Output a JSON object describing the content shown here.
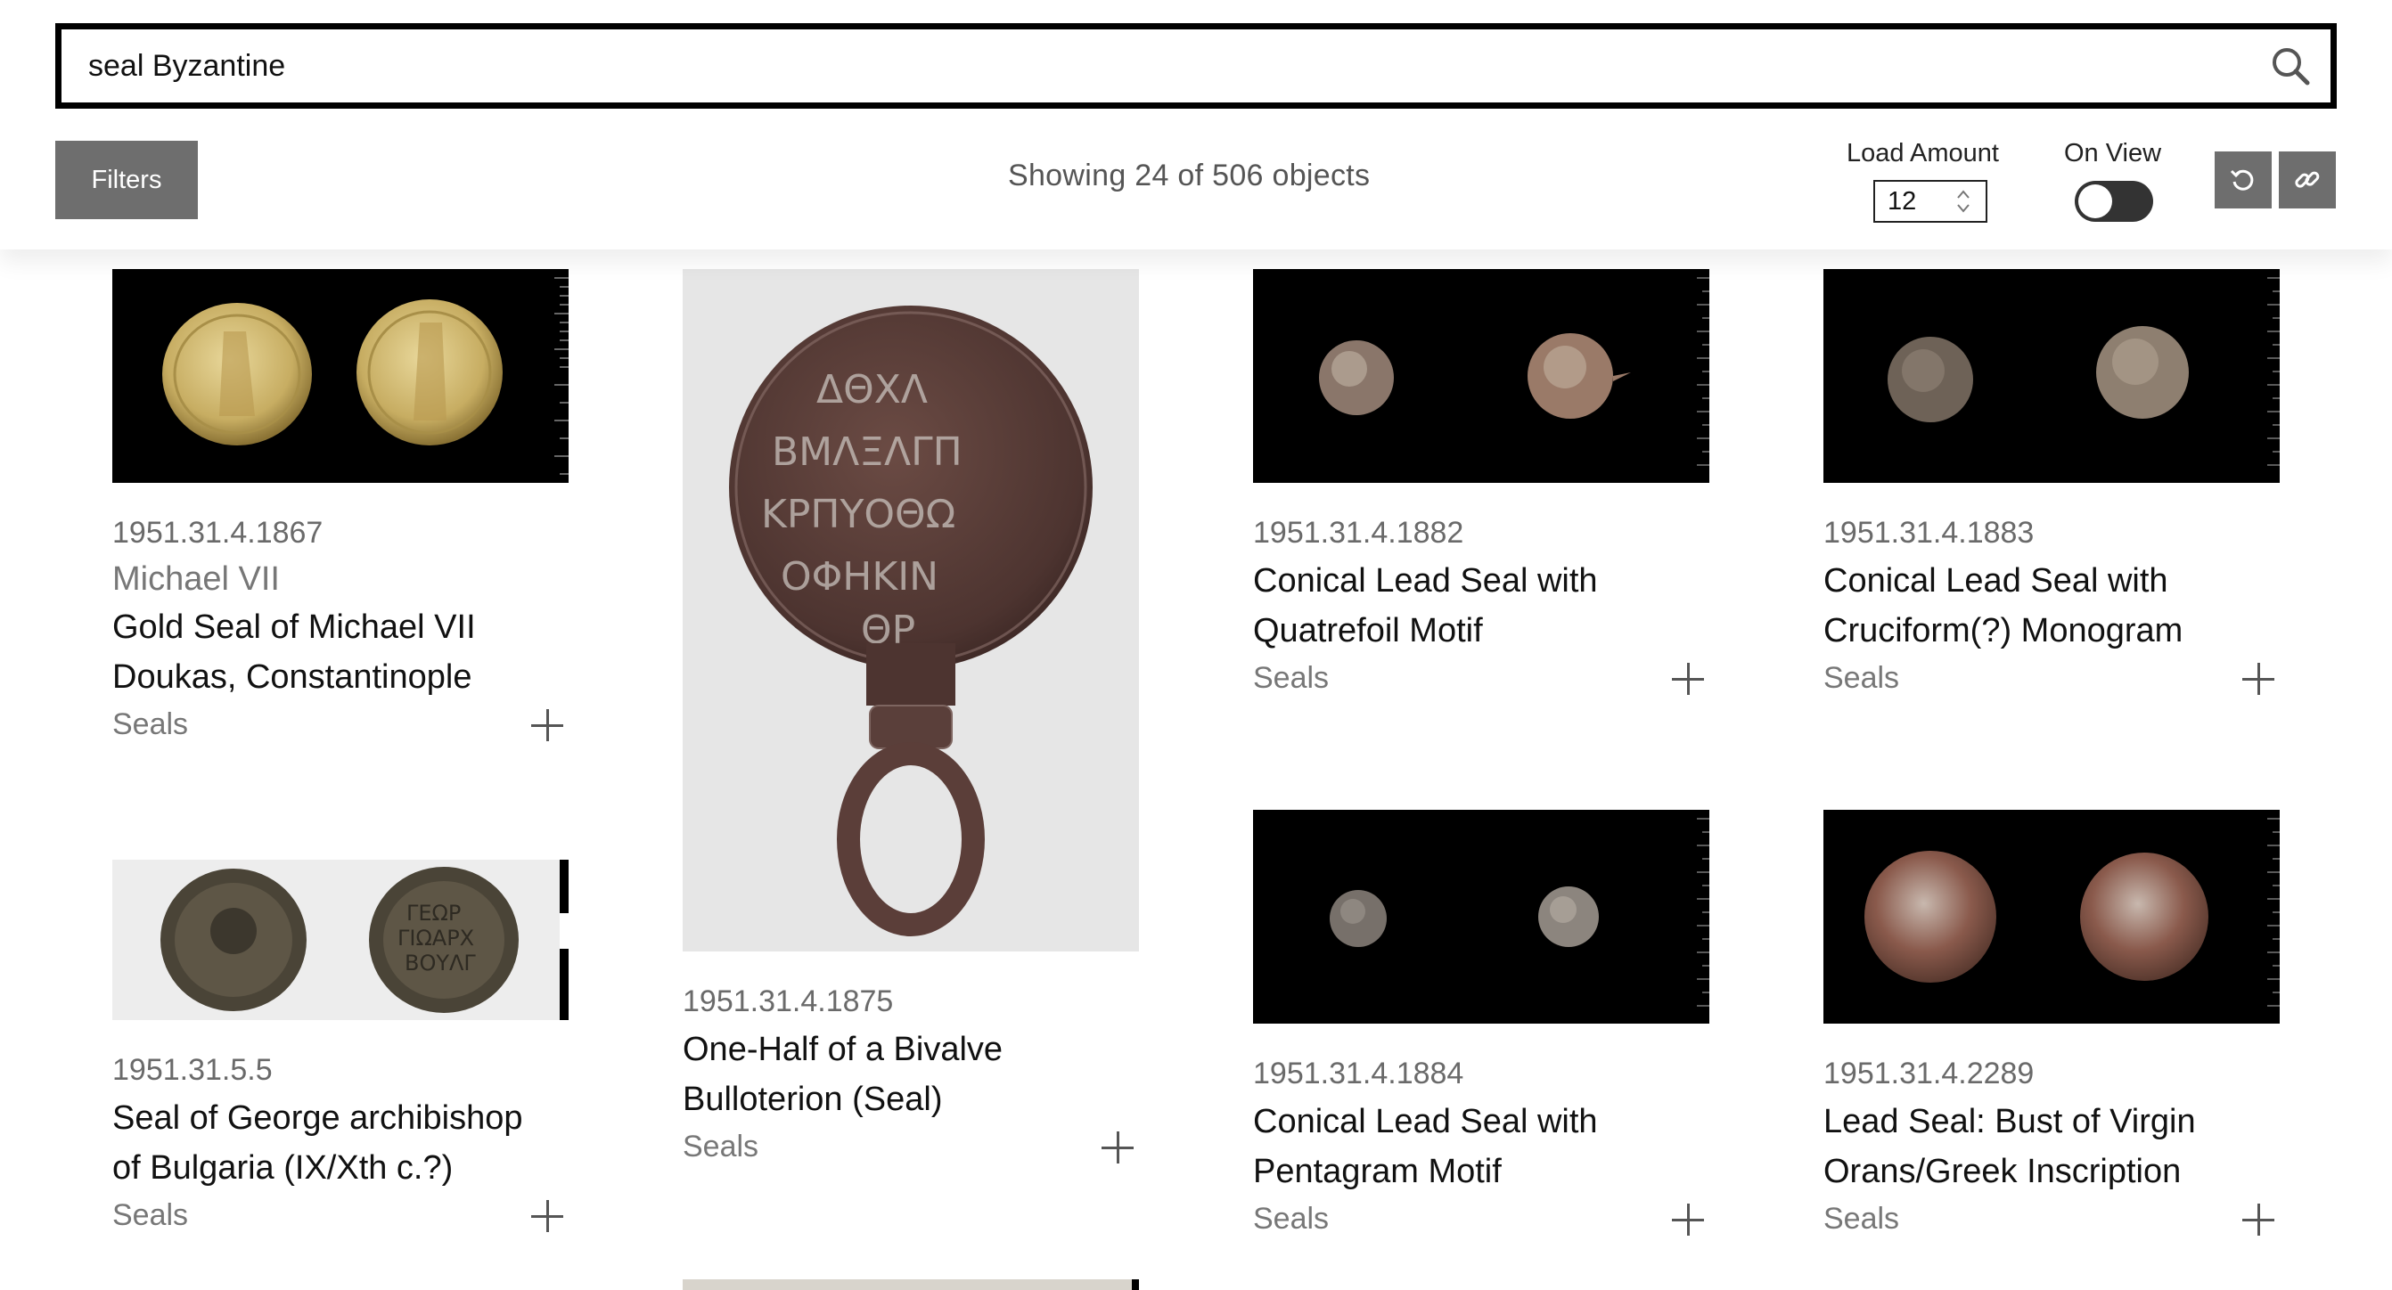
{
  "search": {
    "query": "seal Byzantine"
  },
  "toolbar": {
    "filters_label": "Filters",
    "showing_text": "Showing 24 of 506 objects",
    "load_amount_label": "Load Amount",
    "load_amount_value": "12",
    "on_view_label": "On View",
    "on_view_enabled": false
  },
  "icons": [
    "search-icon",
    "chevron-up-icon",
    "chevron-down-icon",
    "reset-icon",
    "link-icon",
    "plus-icon"
  ],
  "results": [
    {
      "accession": "1951.31.4.1867",
      "maker": "Michael VII",
      "title_lines": [
        "Gold Seal of Michael VII",
        "Doukas, Constantinople"
      ],
      "classification": "Seals"
    },
    {
      "accession": "1951.31.4.1875",
      "title_lines": [
        "One-Half of a Bivalve",
        "Bulloterion (Seal)"
      ],
      "classification": "Seals"
    },
    {
      "accession": "1951.31.4.1882",
      "title_lines": [
        "Conical Lead Seal with",
        "Quatrefoil Motif"
      ],
      "classification": "Seals"
    },
    {
      "accession": "1951.31.4.1883",
      "title_lines": [
        "Conical Lead Seal with",
        "Cruciform(?) Monogram"
      ],
      "classification": "Seals"
    },
    {
      "accession": "1951.31.5.5",
      "title_lines": [
        "Seal of George archibishop",
        "of Bulgaria (IX/Xth c.?)"
      ],
      "classification": "Seals"
    },
    {
      "accession": "1951.31.4.1884",
      "title_lines": [
        "Conical Lead Seal with",
        "Pentagram Motif"
      ],
      "classification": "Seals"
    },
    {
      "accession": "1951.31.4.2289",
      "title_lines": [
        "Lead Seal: Bust of Virgin",
        "Orans/Greek Inscription"
      ],
      "classification": "Seals"
    }
  ]
}
